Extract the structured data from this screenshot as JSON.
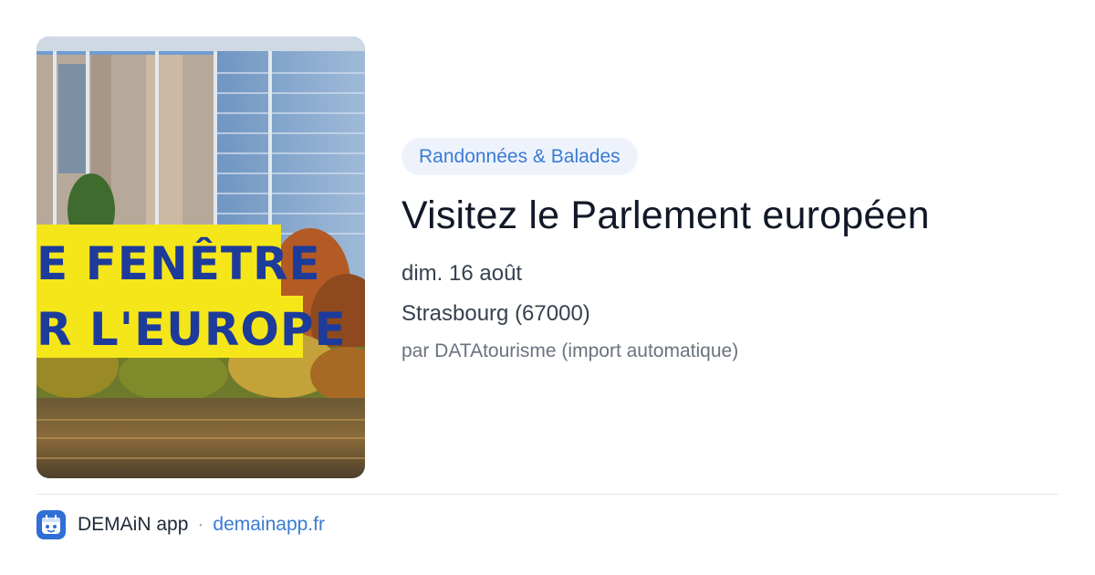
{
  "event": {
    "image_alt": "Parlement européen, Strasbourg",
    "banner_line1": "E FENÊTRE",
    "banner_line2": "R L'EUROPE",
    "category": "Randonnées & Balades",
    "title": "Visitez le Parlement européen",
    "date": "dim. 16 août",
    "location": "Strasbourg (67000)",
    "author": "par DATAtourisme (import automatique)"
  },
  "footer": {
    "app_icon": "demain-logo-icon",
    "app_name": "DEMAiN app",
    "separator": "·",
    "site": "demainapp.fr"
  },
  "colors": {
    "accent": "#3a7bd5",
    "chip_bg": "#eef3fb",
    "banner_yellow": "#f5e61a",
    "banner_text": "#1d3b9a"
  }
}
